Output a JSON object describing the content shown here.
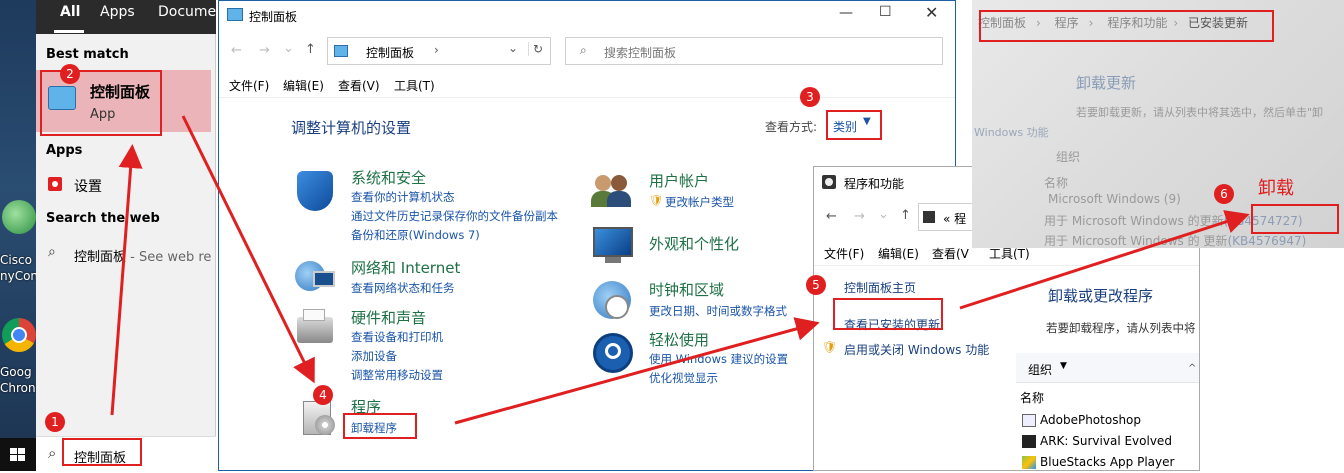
{
  "desktop": {
    "icons": [
      {
        "label": "Cisco\nnyCon"
      },
      {
        "label": "Goog\nChron"
      }
    ]
  },
  "start_menu": {
    "tabs": [
      "All",
      "Apps",
      "Docume"
    ],
    "best_match_heading": "Best match",
    "best_match": {
      "title": "控制面板",
      "subtitle": "App"
    },
    "apps_heading": "Apps",
    "apps": [
      {
        "label": "设置"
      }
    ],
    "web_heading": "Search the web",
    "web_result": {
      "query": "控制面板",
      "suffix": " - See web re"
    },
    "search_value": "控制面板"
  },
  "control_panel": {
    "title": "控制面板",
    "address": "控制面板",
    "search_placeholder": "搜索控制面板",
    "menu": [
      "文件(F)",
      "编辑(E)",
      "查看(V)",
      "工具(T)"
    ],
    "heading": "调整计算机的设置",
    "view_label": "查看方式:",
    "view_value": "类别",
    "categories_left": [
      {
        "title": "系统和安全",
        "links": [
          "查看你的计算机状态",
          "通过文件历史记录保存你的文件备份副本",
          "备份和还原(Windows 7)"
        ]
      },
      {
        "title": "网络和 Internet",
        "links": [
          "查看网络状态和任务"
        ]
      },
      {
        "title": "硬件和声音",
        "links": [
          "查看设备和打印机",
          "添加设备",
          "调整常用移动设置"
        ]
      },
      {
        "title": "程序",
        "links": [
          "卸载程序"
        ]
      }
    ],
    "categories_right": [
      {
        "title": "用户帐户",
        "links": [
          "更改帐户类型"
        ]
      },
      {
        "title": "外观和个性化",
        "links": []
      },
      {
        "title": "时钟和区域",
        "links": [
          "更改日期、时间或数字格式"
        ]
      },
      {
        "title": "轻松使用",
        "links": [
          "使用 Windows 建议的设置",
          "优化视觉显示"
        ]
      }
    ]
  },
  "programs_window": {
    "title": "程序和功能",
    "address": "« 程",
    "menu": [
      "文件(F)",
      "编辑(E)",
      "查看(V",
      "工具(T)"
    ],
    "sidebar": [
      "控制面板主页",
      "查看已安装的更新",
      "启用或关闭 Windows 功能"
    ],
    "heading": "卸载或更改程序",
    "desc": "若要卸载程序，请从列表中将",
    "organize": "组织",
    "column": "名称",
    "programs": [
      "AdobePhotoshop",
      "ARK: Survival Evolved",
      "BlueStacks App Player"
    ]
  },
  "photo": {
    "breadcrumb": [
      "控制面板",
      "程序",
      "程序和功能",
      "已安装更新"
    ],
    "heading": "卸载更新",
    "desc": "若要卸载更新，请从列表中将其选中，然后单击\"卸",
    "organize": "组织",
    "column": "名称",
    "group": "Microsoft Windows (9)",
    "rows": [
      {
        "name": "用于 Microsoft Windows 的更新",
        "kb": "(KB4574727)"
      },
      {
        "name": "用于 Microsoft Windows 的 更新",
        "kb": "(KB4576947)"
      }
    ],
    "side": "Windows 功能"
  },
  "annotations": {
    "steps": [
      "1",
      "2",
      "3",
      "4",
      "5",
      "6"
    ],
    "uninstall_label": "卸载",
    "accent": "#e02020"
  }
}
